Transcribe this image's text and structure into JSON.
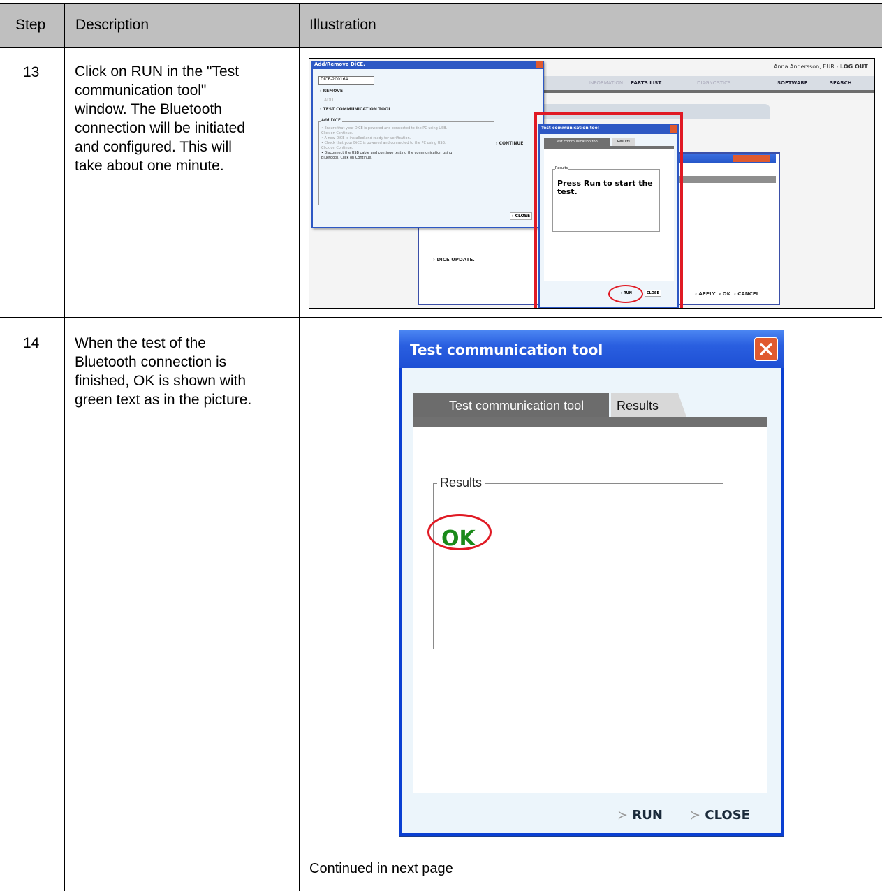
{
  "table": {
    "headers": {
      "step": "Step",
      "description": "Description",
      "illustration": "Illustration"
    },
    "rows": [
      {
        "step": "13",
        "description": [
          "Click on RUN in the \"Test",
          "communication tool\"",
          "window. The Bluetooth",
          "connection will be initiated",
          "and configured. This will",
          "take about one minute."
        ]
      },
      {
        "step": "14",
        "description": [
          "When the test of the",
          "Bluetooth connection is",
          "finished, OK is shown with",
          "green text as in the picture."
        ]
      },
      {
        "step": "",
        "continued": "Continued in next page"
      }
    ]
  },
  "shot13": {
    "add_remove_title": "Add/Remove DiCE.",
    "dice_select": "DiCE-200164",
    "remove": "REMOVE",
    "add": "ADD",
    "test_tool": "TEST COMMUNICATION TOOL",
    "add_dice_label": "Add DiCE.",
    "instructions": [
      "• Ensure that your DiCE is powered and connected to the PC using USB.",
      "Click on Continue.",
      "• A new DiCE is installed and ready for verification.",
      "• Check that your DiCE is powered and connected to the PC using USB.",
      "Click on Continue.",
      "• Disconnect the USB cable and continue testing the communication using",
      "Bluetooth. Click on Continue."
    ],
    "continue": "CONTINUE",
    "close": "CLOSE",
    "user": "Anna Andersson, EUR",
    "logout": "LOG OUT",
    "nav": [
      "INFORMATION",
      "PARTS LIST",
      "DIAGNOSTICS",
      "SOFTWARE",
      "SEARCH"
    ],
    "dice_update": "DICE UPDATE.",
    "bottom_buttons": [
      "APPLY",
      "OK",
      "CANCEL"
    ],
    "tct_title": "Test communication tool",
    "tct_tabs": [
      "Test communication tool",
      "Results"
    ],
    "tct_group": "Results",
    "tct_message": "Press Run to start the test.",
    "tct_run": "RUN",
    "tct_close": "CLOSE"
  },
  "dialog14": {
    "title": "Test communication tool",
    "tabs": [
      "Test communication tool",
      "Results"
    ],
    "group_label": "Results",
    "result": "OK",
    "run": "RUN",
    "close": "CLOSE",
    "result_color": "#1a8a1a",
    "highlight_color": "#e01a24"
  }
}
